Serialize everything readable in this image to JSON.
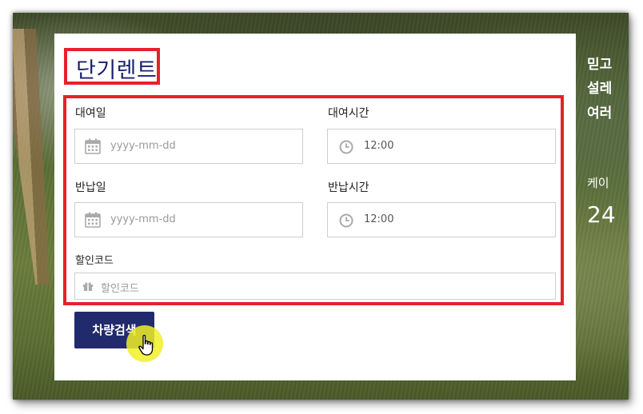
{
  "hero": {
    "line1": "믿고",
    "line2": "설레",
    "line3": "여러",
    "line4": "케이",
    "line5": "24"
  },
  "form": {
    "title": "단기렌트",
    "rental_date": {
      "label": "대여일",
      "placeholder": "yyyy-mm-dd"
    },
    "rental_time": {
      "label": "대여시간",
      "value": "12:00"
    },
    "return_date": {
      "label": "반납일",
      "placeholder": "yyyy-mm-dd"
    },
    "return_time": {
      "label": "반납시간",
      "value": "12:00"
    },
    "discount_code": {
      "label": "할인코드",
      "placeholder": "할인코드"
    },
    "search_button": "차량검색"
  },
  "icons": {
    "date": "calendar-icon",
    "time": "clock-icon",
    "code": "gift-icon",
    "pointer": "hand-pointer-icon"
  },
  "colors": {
    "accent": "#222a6e",
    "title": "#1a1f6e",
    "highlight": "#e8202a"
  }
}
